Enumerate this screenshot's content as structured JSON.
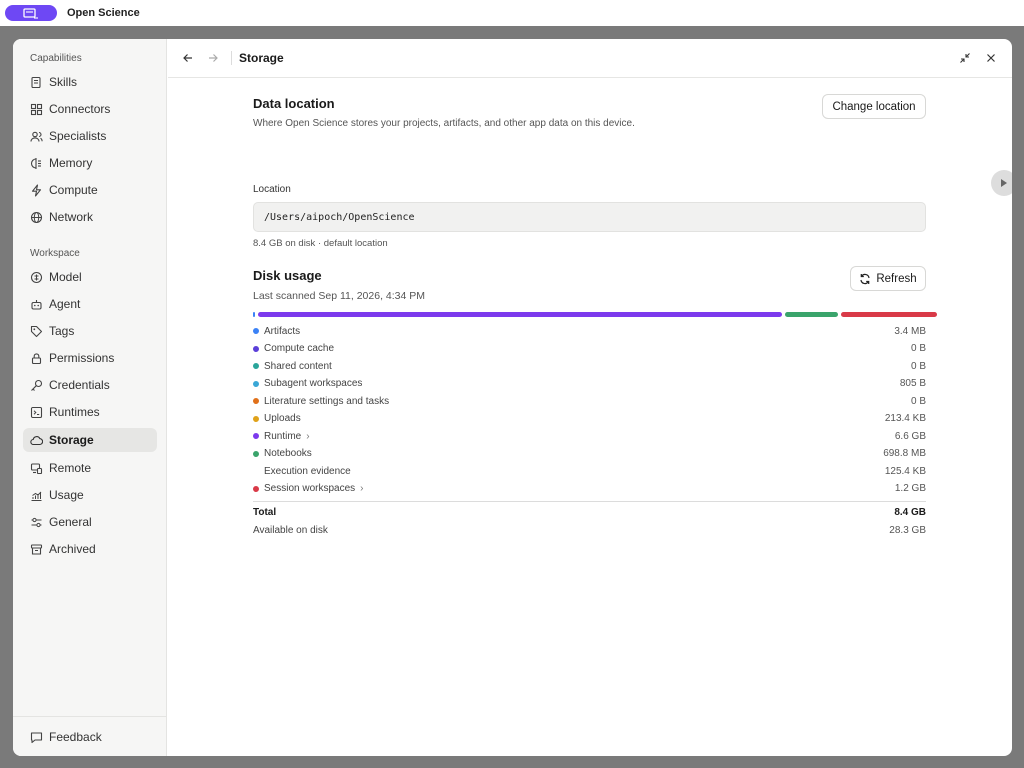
{
  "app": {
    "name": "Open Science"
  },
  "sidebar": {
    "capabilities_label": "Capabilities",
    "workspace_label": "Workspace",
    "capabilities": [
      {
        "label": "Skills",
        "icon": "skills-icon"
      },
      {
        "label": "Connectors",
        "icon": "connectors-icon"
      },
      {
        "label": "Specialists",
        "icon": "specialists-icon"
      },
      {
        "label": "Memory",
        "icon": "memory-icon"
      },
      {
        "label": "Compute",
        "icon": "compute-icon"
      },
      {
        "label": "Network",
        "icon": "globe-icon"
      }
    ],
    "workspace": [
      {
        "label": "Model",
        "icon": "model-icon"
      },
      {
        "label": "Agent",
        "icon": "agent-icon"
      },
      {
        "label": "Tags",
        "icon": "tag-icon"
      },
      {
        "label": "Permissions",
        "icon": "lock-icon"
      },
      {
        "label": "Credentials",
        "icon": "key-icon"
      },
      {
        "label": "Runtimes",
        "icon": "terminal-icon"
      },
      {
        "label": "Storage",
        "icon": "cloud-icon",
        "active": true
      },
      {
        "label": "Remote",
        "icon": "remote-icon"
      },
      {
        "label": "Usage",
        "icon": "usage-chart-icon"
      },
      {
        "label": "General",
        "icon": "sliders-icon"
      },
      {
        "label": "Archived",
        "icon": "archive-icon"
      }
    ],
    "feedback_label": "Feedback"
  },
  "header": {
    "title": "Storage"
  },
  "data_location": {
    "title": "Data location",
    "description": "Where Open Science stores your projects, artifacts, and other app data on this device.",
    "change_button": "Change location",
    "location_label": "Location",
    "path": "/Users/aipoch/OpenScience",
    "disk_note": "8.4 GB on disk · default location"
  },
  "disk_usage": {
    "title": "Disk usage",
    "last_scanned": "Last scanned Sep 11, 2026, 4:34 PM",
    "refresh_button": "Refresh",
    "bar_segments": [
      {
        "name": "Artifacts",
        "fraction": 0.003,
        "color": "#3b82f6"
      },
      {
        "name": "Runtime",
        "fraction": 0.783,
        "color": "#7c3aed"
      },
      {
        "name": "Notebooks",
        "fraction": 0.083,
        "color": "#3aa46b"
      },
      {
        "name": "Session workspaces",
        "fraction": 0.143,
        "color": "#d93a48"
      }
    ],
    "items": [
      {
        "label": "Artifacts",
        "value": "3.4 MB",
        "color": "#3b82f6",
        "chevron": false
      },
      {
        "label": "Compute cache",
        "value": "0 B",
        "color": "#5b3fd9",
        "chevron": false
      },
      {
        "label": "Shared content",
        "value": "0 B",
        "color": "#2aa59a",
        "chevron": false
      },
      {
        "label": "Subagent workspaces",
        "value": "805 B",
        "color": "#3aa7d6",
        "chevron": false
      },
      {
        "label": "Literature settings and tasks",
        "value": "0 B",
        "color": "#e0701a",
        "chevron": false
      },
      {
        "label": "Uploads",
        "value": "213.4 KB",
        "color": "#e0a21a",
        "chevron": false
      },
      {
        "label": "Runtime",
        "value": "6.6 GB",
        "color": "#7c3aed",
        "chevron": true
      },
      {
        "label": "Notebooks",
        "value": "698.8 MB",
        "color": "#3aa46b",
        "chevron": false
      },
      {
        "label": "Execution evidence",
        "value": "125.4 KB",
        "color": "",
        "chevron": false
      },
      {
        "label": "Session workspaces",
        "value": "1.2 GB",
        "color": "#d93a48",
        "chevron": true
      }
    ],
    "total_label": "Total",
    "total_value": "8.4 GB",
    "available_label": "Available on disk",
    "available_value": "28.3 GB"
  }
}
